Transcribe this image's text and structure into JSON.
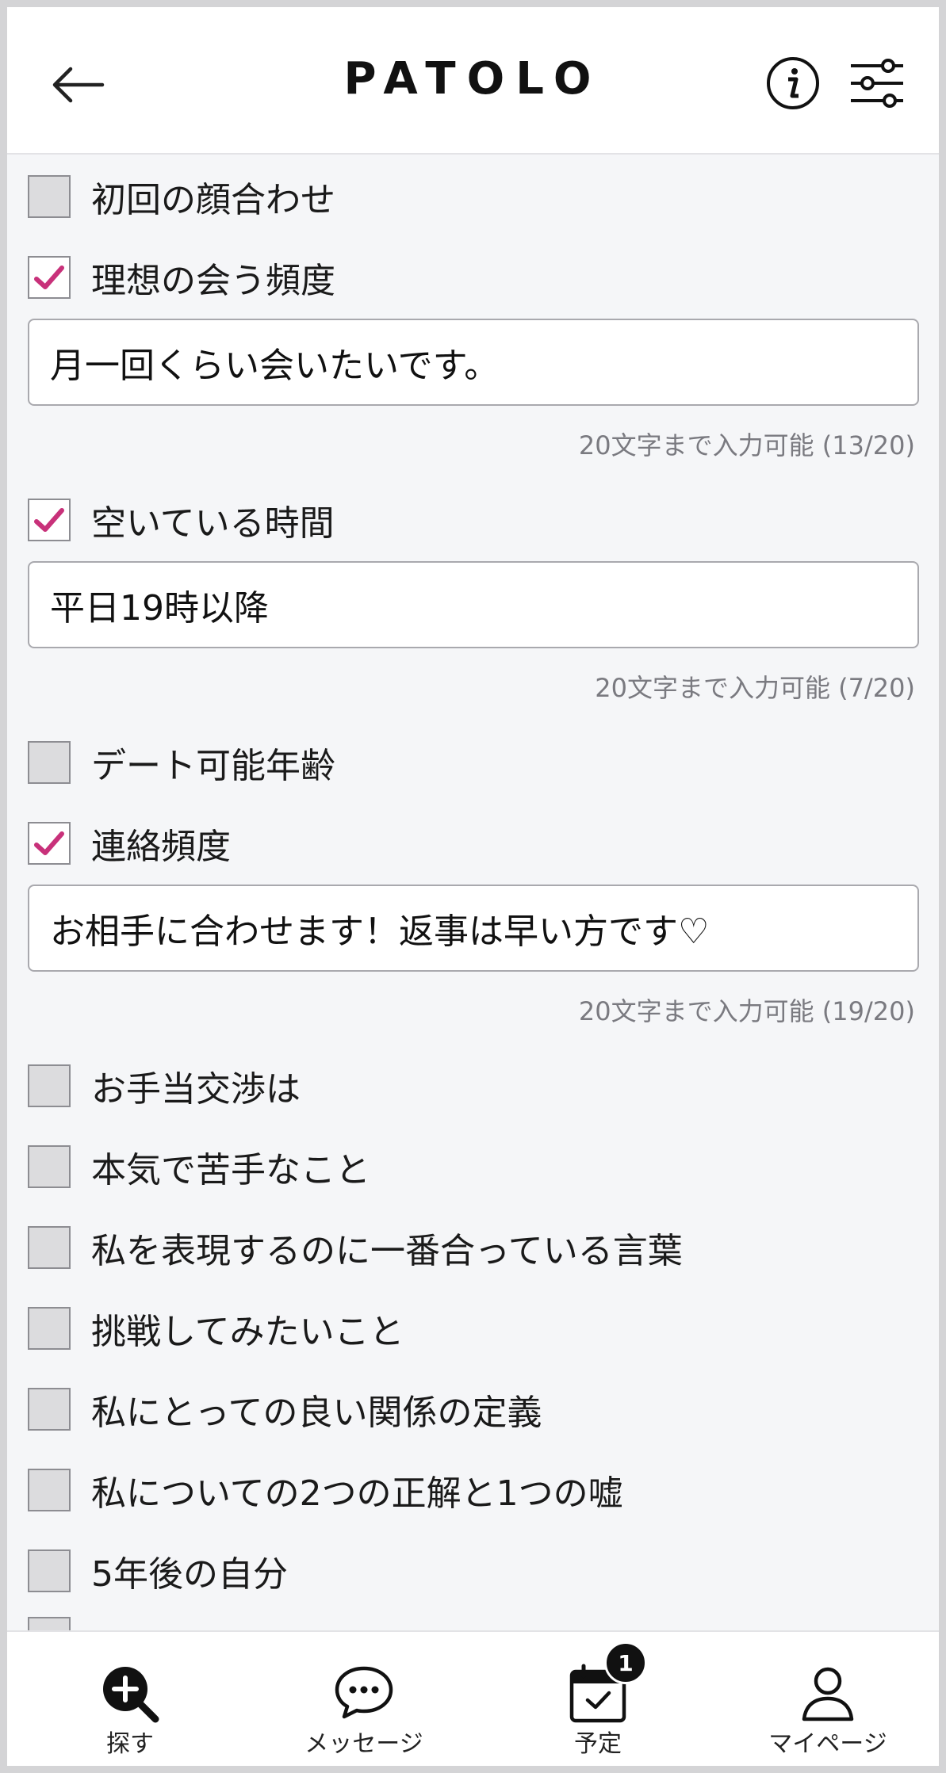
{
  "header": {
    "logo": "PATOLO",
    "back_icon": "arrow-left-icon",
    "info_icon": "info-icon",
    "filter_icon": "sliders-icon"
  },
  "accent_color": "#c8317a",
  "items": [
    {
      "label": "初回の顔合わせ",
      "checked": false
    },
    {
      "label": "理想の会う頻度",
      "checked": true,
      "value": "月一回くらい会いたいです。",
      "counter": "20文字まで入力可能 (13/20)"
    },
    {
      "label": "空いている時間",
      "checked": true,
      "value": "平日19時以降",
      "counter": "20文字まで入力可能 (7/20)"
    },
    {
      "label": "デート可能年齢",
      "checked": false
    },
    {
      "label": "連絡頻度",
      "checked": true,
      "value": "お相手に合わせます！返事は早い方です♡",
      "counter": "20文字まで入力可能 (19/20)"
    },
    {
      "label": "お手当交渉は",
      "checked": false
    },
    {
      "label": "本気で苦手なこと",
      "checked": false
    },
    {
      "label": "私を表現するのに一番合っている言葉",
      "checked": false
    },
    {
      "label": "挑戦してみたいこと",
      "checked": false
    },
    {
      "label": "私にとっての良い関係の定義",
      "checked": false
    },
    {
      "label": "私についての2つの正解と1つの嘘",
      "checked": false
    },
    {
      "label": "5年後の自分",
      "checked": false
    }
  ],
  "nav": {
    "search": {
      "label": "探す",
      "icon": "search-plus-icon"
    },
    "messages": {
      "label": "メッセージ",
      "icon": "chat-bubble-icon"
    },
    "schedule": {
      "label": "予定",
      "icon": "calendar-check-icon",
      "badge": "1"
    },
    "mypage": {
      "label": "マイページ",
      "icon": "user-icon"
    }
  }
}
